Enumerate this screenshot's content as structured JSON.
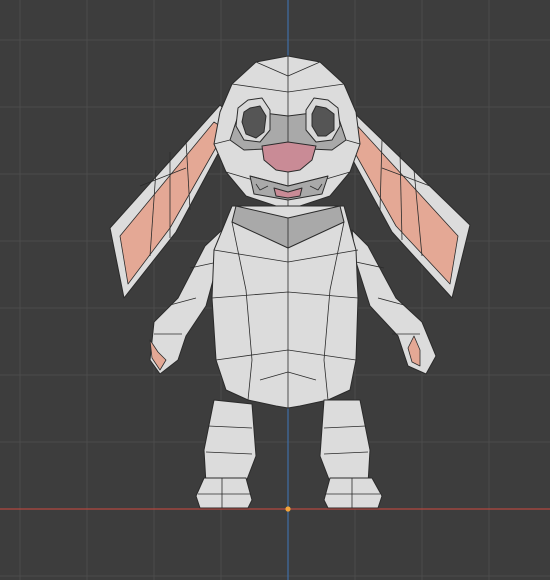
{
  "viewport": {
    "background_color": "#3d3d3d",
    "grid_color": "#4b4b4b",
    "x_axis_color": "#b3473f",
    "z_axis_color": "#3f6ea6",
    "origin_color": "#f3a43a"
  },
  "model": {
    "body_color": "#dcdcdc",
    "shadow_color": "#a9a9a9",
    "wire_color": "#2b2b2b",
    "ear_inner_color": "#e4a895",
    "mouth_color": "#c98b96",
    "eye_color": "#555555",
    "eye_rim_color": "#d8d8d8"
  }
}
